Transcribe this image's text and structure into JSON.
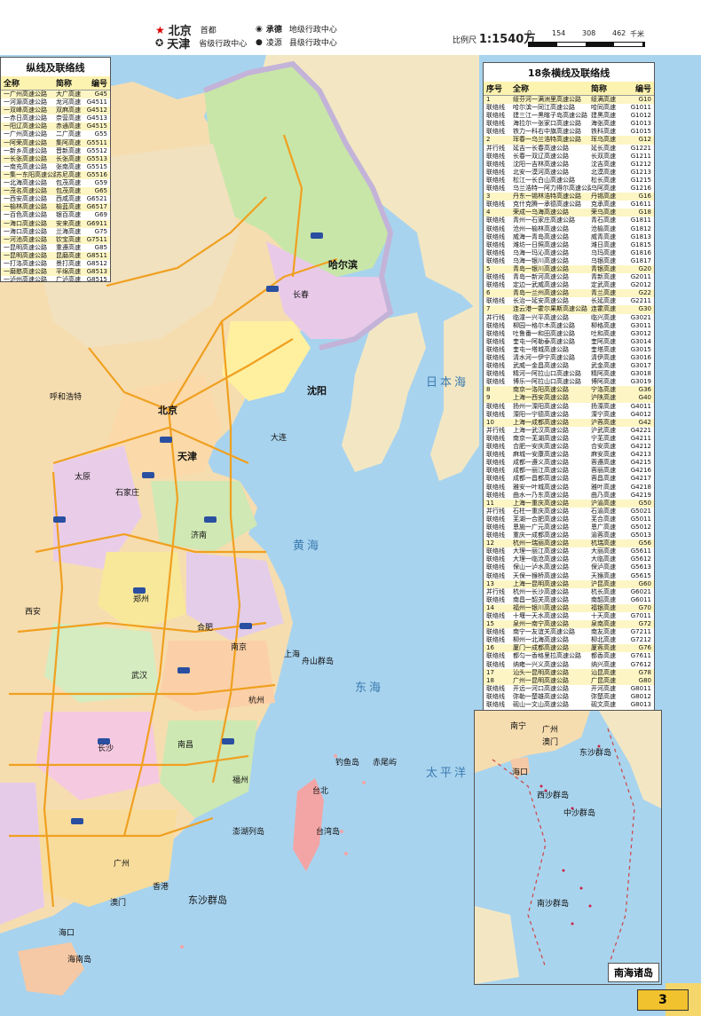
{
  "legend": {
    "capital": "北京",
    "capital_desc": "首都",
    "province_capital": "天津",
    "province_capital_desc": "省级行政中心",
    "prefecture": "承德",
    "prefecture_desc": "地级行政中心",
    "county": "凌源",
    "county_desc": "县级行政中心"
  },
  "scale": {
    "label": "比例尺",
    "value": "1:1540万",
    "ticks": [
      "0",
      "154",
      "308",
      "462"
    ],
    "unit": "千米"
  },
  "left_panel": {
    "title": "纵线及联络线",
    "headers": {
      "name": "全称",
      "short": "简称",
      "code": "编号"
    },
    "rows": [
      {
        "name": "一广州高速公路",
        "short": "大广高速",
        "code": "G45"
      },
      {
        "name": "一河源高速公路",
        "short": "龙河高速",
        "code": "G4511"
      },
      {
        "name": "一双峰高速公路",
        "short": "双麻高速",
        "code": "G4512"
      },
      {
        "name": "一赤日高速公路",
        "short": "奈营高速",
        "code": "G4513"
      },
      {
        "name": "一阳辽高速公路",
        "short": "赤通高速",
        "code": "G4515"
      },
      {
        "name": "一广州高速公路",
        "short": "二广高速",
        "code": "G55"
      },
      {
        "name": "一阿荣高速公路",
        "short": "集阿高速",
        "code": "G5511"
      },
      {
        "name": "一新乡高速公路",
        "short": "晋新高速",
        "code": "G5512"
      },
      {
        "name": "一长张高速公路",
        "short": "长张高速",
        "code": "G5513"
      },
      {
        "name": "一南充高速公路",
        "short": "张南高速",
        "code": "G5515"
      },
      {
        "name": "一集一东阳高速公路",
        "short": "苏尼高速",
        "code": "G5516"
      },
      {
        "name": "一北海高速公路",
        "short": "包茂高速",
        "code": "G59"
      },
      {
        "name": "一茂名高速公路",
        "short": "包茂高速",
        "code": "G65"
      },
      {
        "name": "一西安高速公路",
        "short": "西咸高速",
        "code": "G6521"
      },
      {
        "name": "一榆林高速公路",
        "short": "榆蓝高速",
        "code": "G6517"
      },
      {
        "name": "一百色高速公路",
        "short": "银百高速",
        "code": "G69"
      },
      {
        "name": "一海口高速公路",
        "short": "安来高速",
        "code": "G6911"
      },
      {
        "name": "一海口高速公路",
        "short": "兰海高速",
        "code": "G75"
      },
      {
        "name": "一河池高速公路",
        "short": "钦宝高速",
        "code": "G7511"
      },
      {
        "name": "一昆明高速公路",
        "short": "重遵高速",
        "code": "G85"
      },
      {
        "name": "一昆明高速公路",
        "short": "昆磨高速",
        "code": "G8511"
      },
      {
        "name": "一打洛高速公路",
        "short": "景打高速",
        "code": "G8512"
      },
      {
        "name": "一磨憨高速公路",
        "short": "平绵高速",
        "code": "G8513"
      },
      {
        "name": "一泸州高速公路",
        "short": "广泸高速",
        "code": "G8515"
      }
    ]
  },
  "right_panel": {
    "title": "18条横线及联络线",
    "headers": {
      "no": "序号",
      "name": "全称",
      "short": "简称",
      "code": "编号"
    },
    "rows": [
      {
        "no": "1",
        "name": "绥芬河一满洲里高速公路",
        "short": "绥满高速",
        "code": "G10",
        "main": true
      },
      {
        "no": "联络线",
        "name": "哈尔滨一同江高速公路",
        "short": "哈同高速",
        "code": "G1011"
      },
      {
        "no": "联络线",
        "name": "建三江一黑瞎子岛高速公路",
        "short": "建黑高速",
        "code": "G1012"
      },
      {
        "no": "联络线",
        "name": "海拉尔一张家口高速公路",
        "short": "海张高速",
        "code": "G1013"
      },
      {
        "no": "联络线",
        "name": "铁力一科右中旗高速公路",
        "short": "铁科高速",
        "code": "G1015"
      },
      {
        "no": "2",
        "name": "珲春一乌兰浩特高速公路",
        "short": "珲乌高速",
        "code": "G12",
        "main": true
      },
      {
        "no": "并行线",
        "name": "延吉一长春高速公路",
        "short": "延长高速",
        "code": "G1221"
      },
      {
        "no": "联络线",
        "name": "长春一双辽高速公路",
        "short": "长双高速",
        "code": "G1211"
      },
      {
        "no": "联络线",
        "name": "沈阳一吉林高速公路",
        "short": "沈吉高速",
        "code": "G1212"
      },
      {
        "no": "联络线",
        "name": "北安一漠河高速公路",
        "short": "北漠高速",
        "code": "G1213"
      },
      {
        "no": "联络线",
        "name": "松江一长白山高速公路",
        "short": "松长高速",
        "code": "G1215"
      },
      {
        "no": "联络线",
        "name": "乌兰浩特一阿力得尔高速公路",
        "short": "乌阿高速",
        "code": "G1216"
      },
      {
        "no": "3",
        "name": "丹东一锡林浩特高速公路",
        "short": "丹锡高速",
        "code": "G16",
        "main": true
      },
      {
        "no": "联络线",
        "name": "克什克腾一承德高速公路",
        "short": "克承高速",
        "code": "G1611"
      },
      {
        "no": "4",
        "name": "荣成一乌海高速公路",
        "short": "荣乌高速",
        "code": "G18",
        "main": true
      },
      {
        "no": "联络线",
        "name": "青州一石家庄高速公路",
        "short": "青石高速",
        "code": "G1811"
      },
      {
        "no": "联络线",
        "name": "沧州一榆林高速公路",
        "short": "沧榆高速",
        "code": "G1812"
      },
      {
        "no": "联络线",
        "name": "威海一青岛高速公路",
        "short": "威青高速",
        "code": "G1813"
      },
      {
        "no": "联络线",
        "name": "潍坊一日照高速公路",
        "short": "潍日高速",
        "code": "G1815"
      },
      {
        "no": "联络线",
        "name": "乌海一玛沁高速公路",
        "short": "乌玛高速",
        "code": "G1816"
      },
      {
        "no": "联络线",
        "name": "乌海一银川高速公路",
        "short": "乌银高速",
        "code": "G1817"
      },
      {
        "no": "5",
        "name": "青岛一银川高速公路",
        "short": "青银高速",
        "code": "G20",
        "main": true
      },
      {
        "no": "联络线",
        "name": "青岛一新河高速公路",
        "short": "青新高速",
        "code": "G2011"
      },
      {
        "no": "联络线",
        "name": "定边一武威高速公路",
        "short": "定武高速",
        "code": "G2012"
      },
      {
        "no": "6",
        "name": "青岛一兰州高速公路",
        "short": "青兰高速",
        "code": "G22",
        "main": true
      },
      {
        "no": "联络线",
        "name": "长治一延安高速公路",
        "short": "长延高速",
        "code": "G2211"
      },
      {
        "no": "7",
        "name": "连云港一霍尔果斯高速公路",
        "short": "连霍高速",
        "code": "G30",
        "main": true
      },
      {
        "no": "并行线",
        "name": "临潼一兴平高速公路",
        "short": "临兴高速",
        "code": "G3021"
      },
      {
        "no": "联络线",
        "name": "柳园一格尔木高速公路",
        "short": "柳格高速",
        "code": "G3011"
      },
      {
        "no": "联络线",
        "name": "吐鲁番一和田高速公路",
        "short": "吐和高速",
        "code": "G3012"
      },
      {
        "no": "联络线",
        "name": "奎屯一阿勒泰高速公路",
        "short": "奎阿高速",
        "code": "G3014"
      },
      {
        "no": "联络线",
        "name": "奎屯一塔城高速公路",
        "short": "奎塔高速",
        "code": "G3015"
      },
      {
        "no": "联络线",
        "name": "清水河一伊宁高速公路",
        "short": "清伊高速",
        "code": "G3016"
      },
      {
        "no": "联络线",
        "name": "武威一金昌高速公路",
        "short": "武金高速",
        "code": "G3017"
      },
      {
        "no": "联络线",
        "name": "精河一阿拉山口高速公路",
        "short": "精阿高速",
        "code": "G3018"
      },
      {
        "no": "联络线",
        "name": "博乐一阿拉山口高速公路",
        "short": "博阿高速",
        "code": "G3019"
      },
      {
        "no": "8",
        "name": "南京一洛阳高速公路",
        "short": "宁洛高速",
        "code": "G36",
        "main": true
      },
      {
        "no": "9",
        "name": "上海一西安高速公路",
        "short": "沪陕高速",
        "code": "G40",
        "main": true
      },
      {
        "no": "联络线",
        "name": "扬州一溧阳高速公路",
        "short": "扬溧高速",
        "code": "G4011"
      },
      {
        "no": "联络线",
        "name": "溧阳一宁德高速公路",
        "short": "溧宁高速",
        "code": "G4012"
      },
      {
        "no": "10",
        "name": "上海一成都高速公路",
        "short": "沪蓉高速",
        "code": "G42",
        "main": true
      },
      {
        "no": "并行线",
        "name": "上海一武汉高速公路",
        "short": "沪武高速",
        "code": "G4221"
      },
      {
        "no": "联络线",
        "name": "南京一芜湖高速公路",
        "short": "宁芜高速",
        "code": "G4211"
      },
      {
        "no": "联络线",
        "name": "合肥一安庆高速公路",
        "short": "合安高速",
        "code": "G4212"
      },
      {
        "no": "联络线",
        "name": "麻城一安康高速公路",
        "short": "麻安高速",
        "code": "G4213"
      },
      {
        "no": "联络线",
        "name": "成都一遵义高速公路",
        "short": "蓉遵高速",
        "code": "G4215"
      },
      {
        "no": "联络线",
        "name": "成都一丽江高速公路",
        "short": "蓉丽高速",
        "code": "G4216"
      },
      {
        "no": "联络线",
        "name": "成都一昌都高速公路",
        "short": "蓉昌高速",
        "code": "G4217"
      },
      {
        "no": "联络线",
        "name": "雅安一叶城高速公路",
        "short": "雅叶高速",
        "code": "G4218"
      },
      {
        "no": "联络线",
        "name": "曲水一乃东高速公路",
        "short": "曲乃高速",
        "code": "G4219"
      },
      {
        "no": "11",
        "name": "上海一重庆高速公路",
        "short": "沪渝高速",
        "code": "G50",
        "main": true
      },
      {
        "no": "并行线",
        "name": "石柱一重庆高速公路",
        "short": "石渝高速",
        "code": "G5021"
      },
      {
        "no": "联络线",
        "name": "芜湖一合肥高速公路",
        "short": "芜合高速",
        "code": "G5011"
      },
      {
        "no": "联络线",
        "name": "恩施一广元高速公路",
        "short": "恩广高速",
        "code": "G5012"
      },
      {
        "no": "联络线",
        "name": "重庆一成都高速公路",
        "short": "渝蓉高速",
        "code": "G5013"
      },
      {
        "no": "12",
        "name": "杭州一瑞丽高速公路",
        "short": "杭瑞高速",
        "code": "G56",
        "main": true
      },
      {
        "no": "联络线",
        "name": "大理一丽江高速公路",
        "short": "大丽高速",
        "code": "G5611"
      },
      {
        "no": "联络线",
        "name": "大理一临沧高速公路",
        "short": "大临高速",
        "code": "G5612"
      },
      {
        "no": "联络线",
        "name": "保山一泸水高速公路",
        "short": "保泸高速",
        "code": "G5613"
      },
      {
        "no": "联络线",
        "name": "天保一猴桥高速公路",
        "short": "天猴高速",
        "code": "G5615"
      },
      {
        "no": "13",
        "name": "上海一昆明高速公路",
        "short": "沪昆高速",
        "code": "G60",
        "main": true
      },
      {
        "no": "并行线",
        "name": "杭州一长沙高速公路",
        "short": "杭长高速",
        "code": "G6021"
      },
      {
        "no": "联络线",
        "name": "南昌一韶关高速公路",
        "short": "南韶高速",
        "code": "G6011"
      },
      {
        "no": "14",
        "name": "福州一银川高速公路",
        "short": "福银高速",
        "code": "G70",
        "main": true
      },
      {
        "no": "联络线",
        "name": "十堰一天水高速公路",
        "short": "十天高速",
        "code": "G7011"
      },
      {
        "no": "15",
        "name": "泉州一南宁高速公路",
        "short": "泉南高速",
        "code": "G72",
        "main": true
      },
      {
        "no": "联络线",
        "name": "南宁一友谊关高速公路",
        "short": "南友高速",
        "code": "G7211"
      },
      {
        "no": "联络线",
        "name": "柳州一北海高速公路",
        "short": "柳北高速",
        "code": "G7212"
      },
      {
        "no": "16",
        "name": "厦门一成都高速公路",
        "short": "厦蓉高速",
        "code": "G76",
        "main": true
      },
      {
        "no": "联络线",
        "name": "都匀一香格里拉高速公路",
        "short": "都香高速",
        "code": "G7611"
      },
      {
        "no": "联络线",
        "name": "纳雍一兴义高速公路",
        "short": "纳兴高速",
        "code": "G7612"
      },
      {
        "no": "17",
        "name": "汕头一昆明高速公路",
        "short": "汕昆高速",
        "code": "G78",
        "main": true
      },
      {
        "no": "18",
        "name": "广州一昆明高速公路",
        "short": "广昆高速",
        "code": "G80",
        "main": true
      },
      {
        "no": "联络线",
        "name": "开远一河口高速公路",
        "short": "开河高速",
        "code": "G8011"
      },
      {
        "no": "联络线",
        "name": "弥勒一楚雄高速公路",
        "short": "弥楚高速",
        "code": "G8012"
      },
      {
        "no": "联络线",
        "name": "砚山一文山高速公路",
        "short": "砚文高速",
        "code": "G8013"
      }
    ]
  },
  "map_labels": [
    {
      "id": "beijing",
      "text": "北京",
      "cls": "cap"
    },
    {
      "id": "tianjin",
      "text": "天津",
      "cls": "cap"
    },
    {
      "id": "shenyang",
      "text": "沈阳",
      "cls": "cap"
    },
    {
      "id": "harbin",
      "text": "哈尔滨",
      "cls": "cap"
    },
    {
      "id": "changchun",
      "text": "长春",
      "cls": ""
    },
    {
      "id": "dalian",
      "text": "大连",
      "cls": ""
    },
    {
      "id": "shijiazhuang",
      "text": "石家庄",
      "cls": ""
    },
    {
      "id": "jinan",
      "text": "济南",
      "cls": ""
    },
    {
      "id": "zhengzhou",
      "text": "郑州",
      "cls": ""
    },
    {
      "id": "xian",
      "text": "西安",
      "cls": ""
    },
    {
      "id": "wuhan",
      "text": "武汉",
      "cls": ""
    },
    {
      "id": "nanjing",
      "text": "南京",
      "cls": ""
    },
    {
      "id": "shanghai",
      "text": "上海",
      "cls": ""
    },
    {
      "id": "hangzhou",
      "text": "杭州",
      "cls": ""
    },
    {
      "id": "changsha",
      "text": "长沙",
      "cls": ""
    },
    {
      "id": "nanchang",
      "text": "南昌",
      "cls": ""
    },
    {
      "id": "fuzhou",
      "text": "福州",
      "cls": ""
    },
    {
      "id": "guangzhou",
      "text": "广州",
      "cls": ""
    },
    {
      "id": "xianggang",
      "text": "香港",
      "cls": ""
    },
    {
      "id": "aomen",
      "text": "澳门",
      "cls": ""
    },
    {
      "id": "taibei",
      "text": "台北",
      "cls": ""
    },
    {
      "id": "haikou",
      "text": "海口",
      "cls": ""
    },
    {
      "id": "huhehaote",
      "text": "呼和浩特",
      "cls": ""
    },
    {
      "id": "taiyuan",
      "text": "太原",
      "cls": ""
    },
    {
      "id": "hefei",
      "text": "合肥",
      "cls": ""
    },
    {
      "id": "taiwan_island",
      "text": "台湾岛",
      "cls": ""
    },
    {
      "id": "dongsha",
      "text": "东沙群岛",
      "cls": ""
    },
    {
      "id": "penghu",
      "text": "澎湖列岛",
      "cls": ""
    },
    {
      "id": "diaoyudao",
      "text": "钓鱼岛",
      "cls": ""
    },
    {
      "id": "chiweiyu",
      "text": "赤尾屿",
      "cls": ""
    },
    {
      "id": "zhoushan",
      "text": "舟山群岛",
      "cls": ""
    },
    {
      "id": "hainan",
      "text": "海南岛",
      "cls": ""
    },
    {
      "id": "sea_east",
      "text": "东海",
      "cls": "sea"
    },
    {
      "id": "sea_yellow",
      "text": "黄海",
      "cls": "sea"
    },
    {
      "id": "sea_japan",
      "text": "日本海",
      "cls": "sea"
    },
    {
      "id": "sea_pacific",
      "text": "太平洋",
      "cls": "sea"
    }
  ],
  "inset": {
    "title": "南海诸岛",
    "labels": [
      "南宁",
      "广州",
      "澳门",
      "东沙群岛",
      "西沙群岛",
      "中沙群岛",
      "南沙群岛",
      "海口"
    ]
  },
  "page_number": "3"
}
